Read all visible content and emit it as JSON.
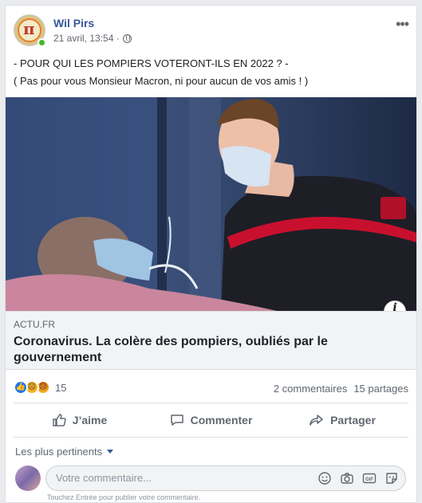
{
  "post": {
    "author": "Wil Pirs",
    "timestamp": "21 avril, 13:54 ·",
    "privacy_icon": "globe-icon",
    "more_icon": "more-icon",
    "text_line1": "- POUR QUI LES POMPIERS VOTERONT-ILS EN 2022 ? -",
    "text_line2": "( Pas pour vous Monsieur Macron, ni pour aucun de vos amis ! )"
  },
  "link": {
    "domain": "ACTU.FR",
    "title": "Coronavirus. La colère des pompiers, oubliés par le gouvernement",
    "info_label": "i"
  },
  "stats": {
    "reaction_count": "15",
    "comments": "2 commentaires",
    "shares": "15 partages",
    "reaction_icons": [
      "like-icon",
      "sad-icon",
      "angry-icon"
    ]
  },
  "actions": {
    "like": "J’aime",
    "comment": "Commenter",
    "share": "Partager"
  },
  "comments": {
    "filter_label": "Les plus pertinents",
    "placeholder": "Votre commentaire...",
    "hint": "Touchez Entrée pour publier votre commentaire."
  },
  "colors": {
    "accent": "#385898",
    "like": "#1877f2",
    "online": "#42b72a"
  }
}
